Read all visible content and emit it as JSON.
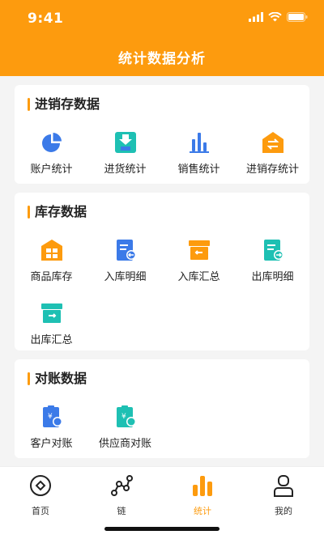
{
  "status_bar": {
    "time": "9:41"
  },
  "header": {
    "title": "统计数据分析"
  },
  "sections": [
    {
      "title": "进销存数据",
      "items": [
        {
          "label": "账户统计",
          "icon": "pie-chart-icon"
        },
        {
          "label": "进货统计",
          "icon": "stock-in-icon"
        },
        {
          "label": "销售统计",
          "icon": "bar-chart-icon"
        },
        {
          "label": "进销存统计",
          "icon": "exchange-icon"
        }
      ]
    },
    {
      "title": "库存数据",
      "items": [
        {
          "label": "商品库存",
          "icon": "warehouse-icon"
        },
        {
          "label": "入库明细",
          "icon": "inbound-detail-icon"
        },
        {
          "label": "入库汇总",
          "icon": "inbound-summary-icon"
        },
        {
          "label": "出库明细",
          "icon": "outbound-detail-icon"
        },
        {
          "label": "出库汇总",
          "icon": "outbound-summary-icon"
        }
      ]
    },
    {
      "title": "对账数据",
      "items": [
        {
          "label": "客户对账",
          "icon": "customer-reconcile-icon"
        },
        {
          "label": "供应商对账",
          "icon": "supplier-reconcile-icon"
        }
      ]
    }
  ],
  "tabbar": {
    "items": [
      {
        "label": "首页",
        "icon": "home-icon"
      },
      {
        "label": "链",
        "icon": "chain-icon"
      },
      {
        "label": "统计",
        "icon": "stats-icon",
        "active": true
      },
      {
        "label": "我的",
        "icon": "profile-icon"
      }
    ]
  },
  "colors": {
    "accent": "#fd9b0e",
    "blue": "#3b7ae8",
    "teal": "#1ec0b3"
  }
}
